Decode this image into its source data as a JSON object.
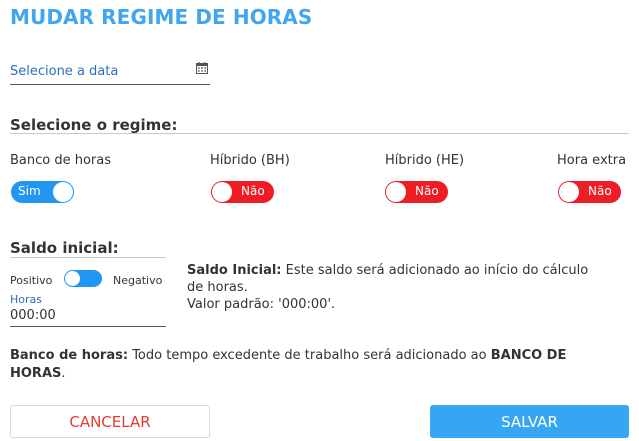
{
  "title": "MUDAR REGIME DE HORAS",
  "date": {
    "placeholder": "Selecione a data",
    "icon": "calendar-icon"
  },
  "regime": {
    "title": "Selecione o regime:",
    "options": [
      {
        "label": "Banco de horas",
        "toggle": "Sim",
        "on": true
      },
      {
        "label": "Híbrido (BH)",
        "toggle": "Não",
        "on": false
      },
      {
        "label": "Híbrido (HE)",
        "toggle": "Não",
        "on": false
      },
      {
        "label": "Hora extra",
        "toggle": "Não",
        "on": false
      }
    ]
  },
  "saldo": {
    "title": "Saldo inicial:",
    "positive_label": "Positivo",
    "negative_label": "Negativo",
    "horas_label": "Horas",
    "horas_value": "000:00",
    "info_bold": "Saldo Inicial:",
    "info_text": " Este saldo será adicionado ao início do cálculo de horas.",
    "info_default": "Valor padrão: '000:00'."
  },
  "description": {
    "bold": "Banco de horas:",
    "text": " Todo tempo excedente de trabalho será adicionado ao ",
    "bold2": "BANCO DE HORAS",
    "end": "."
  },
  "buttons": {
    "cancel": "CANCELAR",
    "save": "SALVAR"
  },
  "colors": {
    "accent": "#3fa6ef",
    "on": "#2196f3",
    "off": "#ee1c24",
    "cancel_text": "#e53935"
  }
}
